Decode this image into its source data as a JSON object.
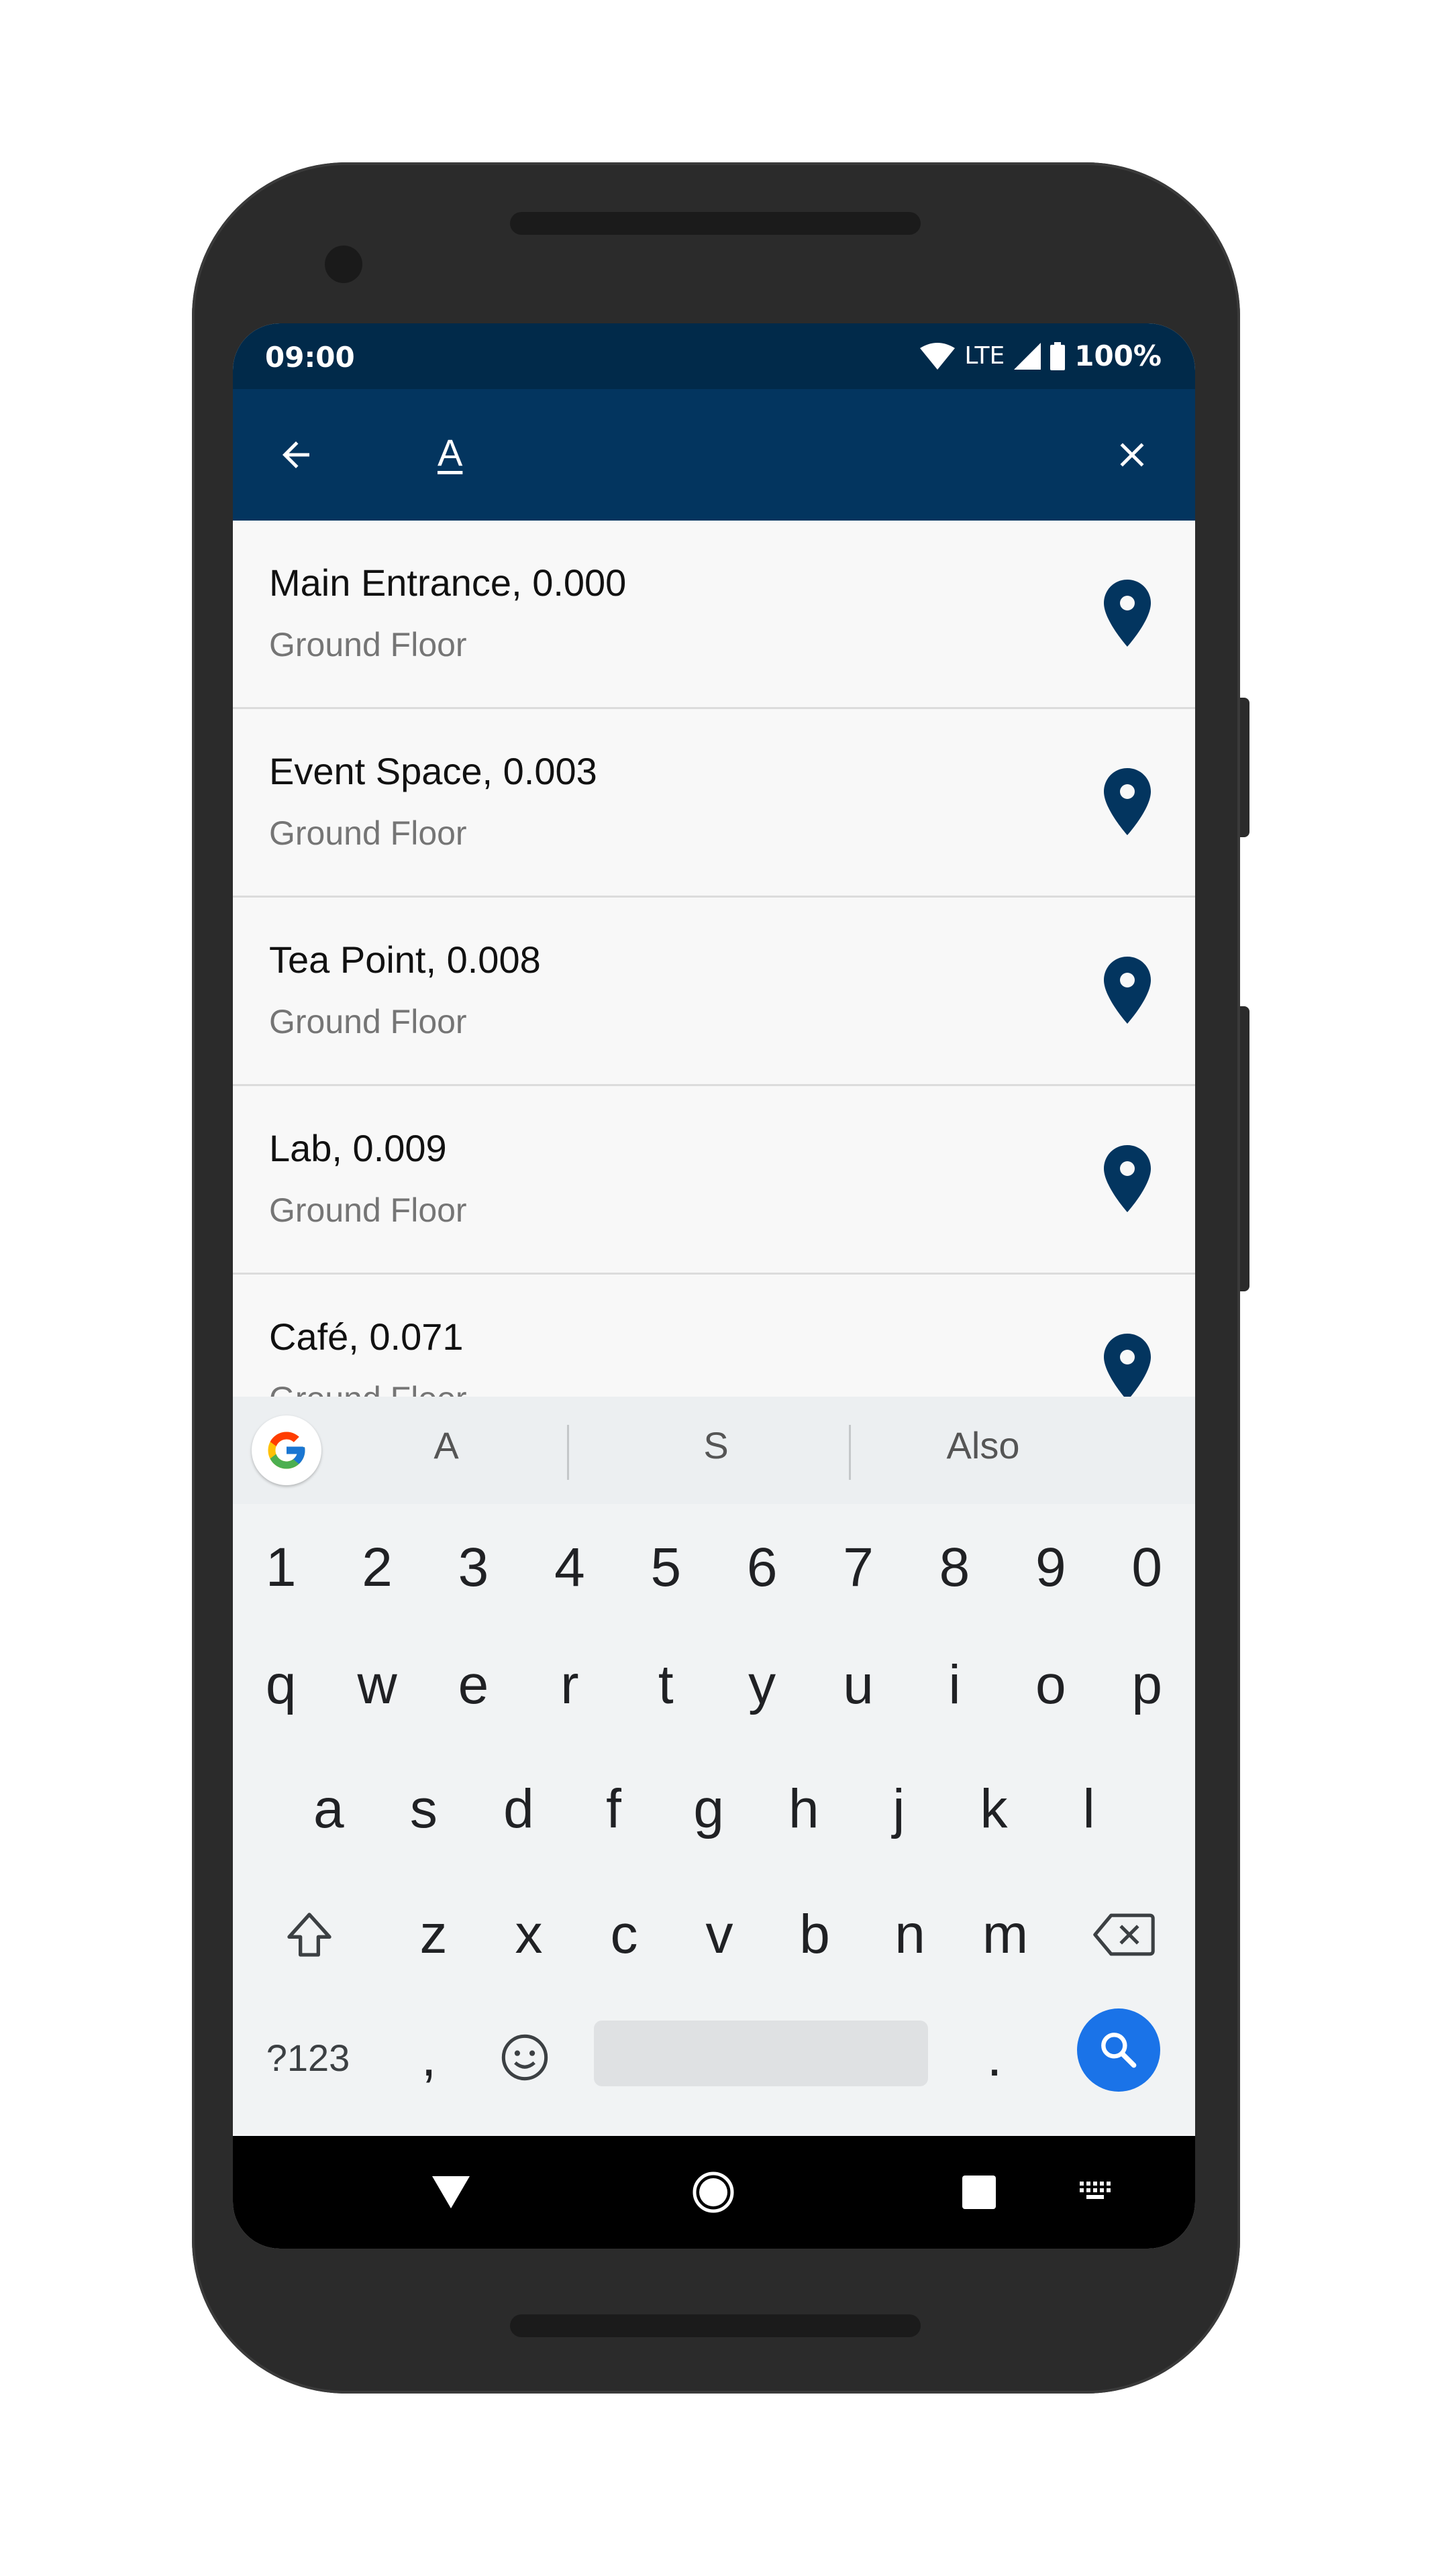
{
  "status_bar": {
    "time": "09:00",
    "network": "LTE",
    "battery": "100%"
  },
  "search": {
    "query": "A"
  },
  "results": [
    {
      "title": "Main Entrance, 0.000",
      "subtitle": "Ground Floor"
    },
    {
      "title": "Event Space, 0.003",
      "subtitle": "Ground Floor"
    },
    {
      "title": "Tea Point, 0.008",
      "subtitle": "Ground Floor"
    },
    {
      "title": "Lab, 0.009",
      "subtitle": "Ground Floor"
    },
    {
      "title": "Café, 0.071",
      "subtitle": "Ground Floor"
    }
  ],
  "keyboard": {
    "suggestions": [
      "A",
      "S",
      "Also"
    ],
    "row_numbers": [
      "1",
      "2",
      "3",
      "4",
      "5",
      "6",
      "7",
      "8",
      "9",
      "0"
    ],
    "row_q": [
      "q",
      "w",
      "e",
      "r",
      "t",
      "y",
      "u",
      "i",
      "o",
      "p"
    ],
    "row_a": [
      "a",
      "s",
      "d",
      "f",
      "g",
      "h",
      "j",
      "k",
      "l"
    ],
    "row_z": [
      "z",
      "x",
      "c",
      "v",
      "b",
      "n",
      "m"
    ],
    "symbols_label": "?123",
    "comma": ",",
    "period": "."
  },
  "colors": {
    "status_bar": "#012a4a",
    "app_bar": "#03355f",
    "pin": "#03355f",
    "search_key": "#1a73e8"
  }
}
